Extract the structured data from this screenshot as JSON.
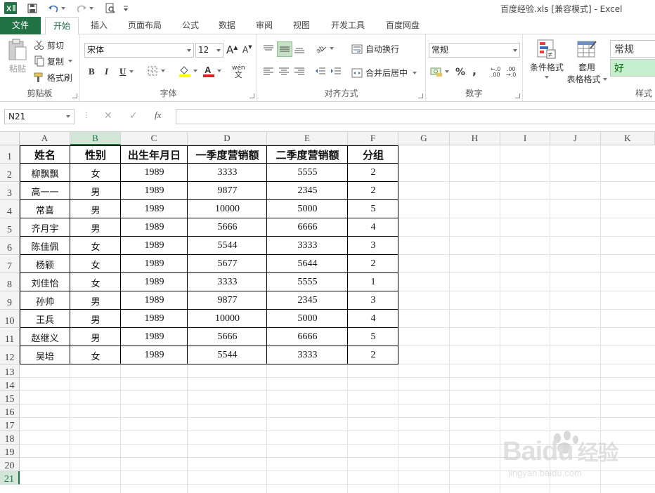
{
  "titlebar": {
    "excel_icon": "excel-icon",
    "title": "百度经验.xls  [兼容模式] - Excel"
  },
  "tabs": [
    "文件",
    "开始",
    "插入",
    "页面布局",
    "公式",
    "数据",
    "审阅",
    "视图",
    "开发工具",
    "百度网盘"
  ],
  "ribbon": {
    "clipboard": {
      "paste": "粘贴",
      "cut": "剪切",
      "copy": "复制",
      "format_painter": "格式刷",
      "label": "剪贴板"
    },
    "font": {
      "font_name": "宋体",
      "font_size": "12",
      "bold": "B",
      "italic": "I",
      "underline": "U",
      "grow": "A",
      "shrink": "A",
      "label": "字体",
      "phonetic": "wén"
    },
    "alignment": {
      "wrap": "自动换行",
      "merge": "合并后居中",
      "label": "对齐方式"
    },
    "number": {
      "format": "常规",
      "percent": "%",
      "comma": ",",
      "label": "数字"
    },
    "styles": {
      "conditional": "条件格式",
      "table_line1": "套用",
      "table_line2": "表格格式",
      "style_normal": "常规",
      "style_good": "好",
      "label": "样式"
    }
  },
  "formula_bar": {
    "name_box": "N21",
    "fx": "fx",
    "value": ""
  },
  "columns": [
    "A",
    "B",
    "C",
    "D",
    "E",
    "F",
    "G",
    "H",
    "I",
    "J",
    "K"
  ],
  "rows": [
    "1",
    "2",
    "3",
    "4",
    "5",
    "6",
    "7",
    "8",
    "9",
    "10",
    "11",
    "12",
    "13",
    "14",
    "15",
    "16",
    "17",
    "18",
    "19",
    "20",
    "21"
  ],
  "table": {
    "headers": [
      "姓名",
      "性别",
      "出生年月日",
      "一季度营销额",
      "二季度营销额",
      "分组"
    ],
    "rows": [
      [
        "柳飘飘",
        "女",
        "1989",
        "3333",
        "5555",
        "2"
      ],
      [
        "高一一",
        "男",
        "1989",
        "9877",
        "2345",
        "2"
      ],
      [
        "常喜",
        "男",
        "1989",
        "10000",
        "5000",
        "5"
      ],
      [
        "齐月宇",
        "男",
        "1989",
        "5666",
        "6666",
        "4"
      ],
      [
        "陈佳佩",
        "女",
        "1989",
        "5544",
        "3333",
        "3"
      ],
      [
        "杨颖",
        "女",
        "1989",
        "5677",
        "5644",
        "2"
      ],
      [
        "刘佳怡",
        "女",
        "1989",
        "3333",
        "5555",
        "1"
      ],
      [
        "孙帅",
        "男",
        "1989",
        "9877",
        "2345",
        "3"
      ],
      [
        "王兵",
        "男",
        "1989",
        "10000",
        "5000",
        "4"
      ],
      [
        "赵继义",
        "男",
        "1989",
        "5666",
        "6666",
        "5"
      ],
      [
        "吴培",
        "女",
        "1989",
        "5544",
        "3333",
        "2"
      ]
    ]
  },
  "selection": {
    "column": "B",
    "row": "21"
  },
  "watermark": {
    "brand": "Baidu",
    "brand_cn": "经验",
    "url": "jingyan.baidu.com"
  },
  "colors": {
    "excel_green": "#217346",
    "good_bg": "#c6efce",
    "good_text": "#006100"
  }
}
